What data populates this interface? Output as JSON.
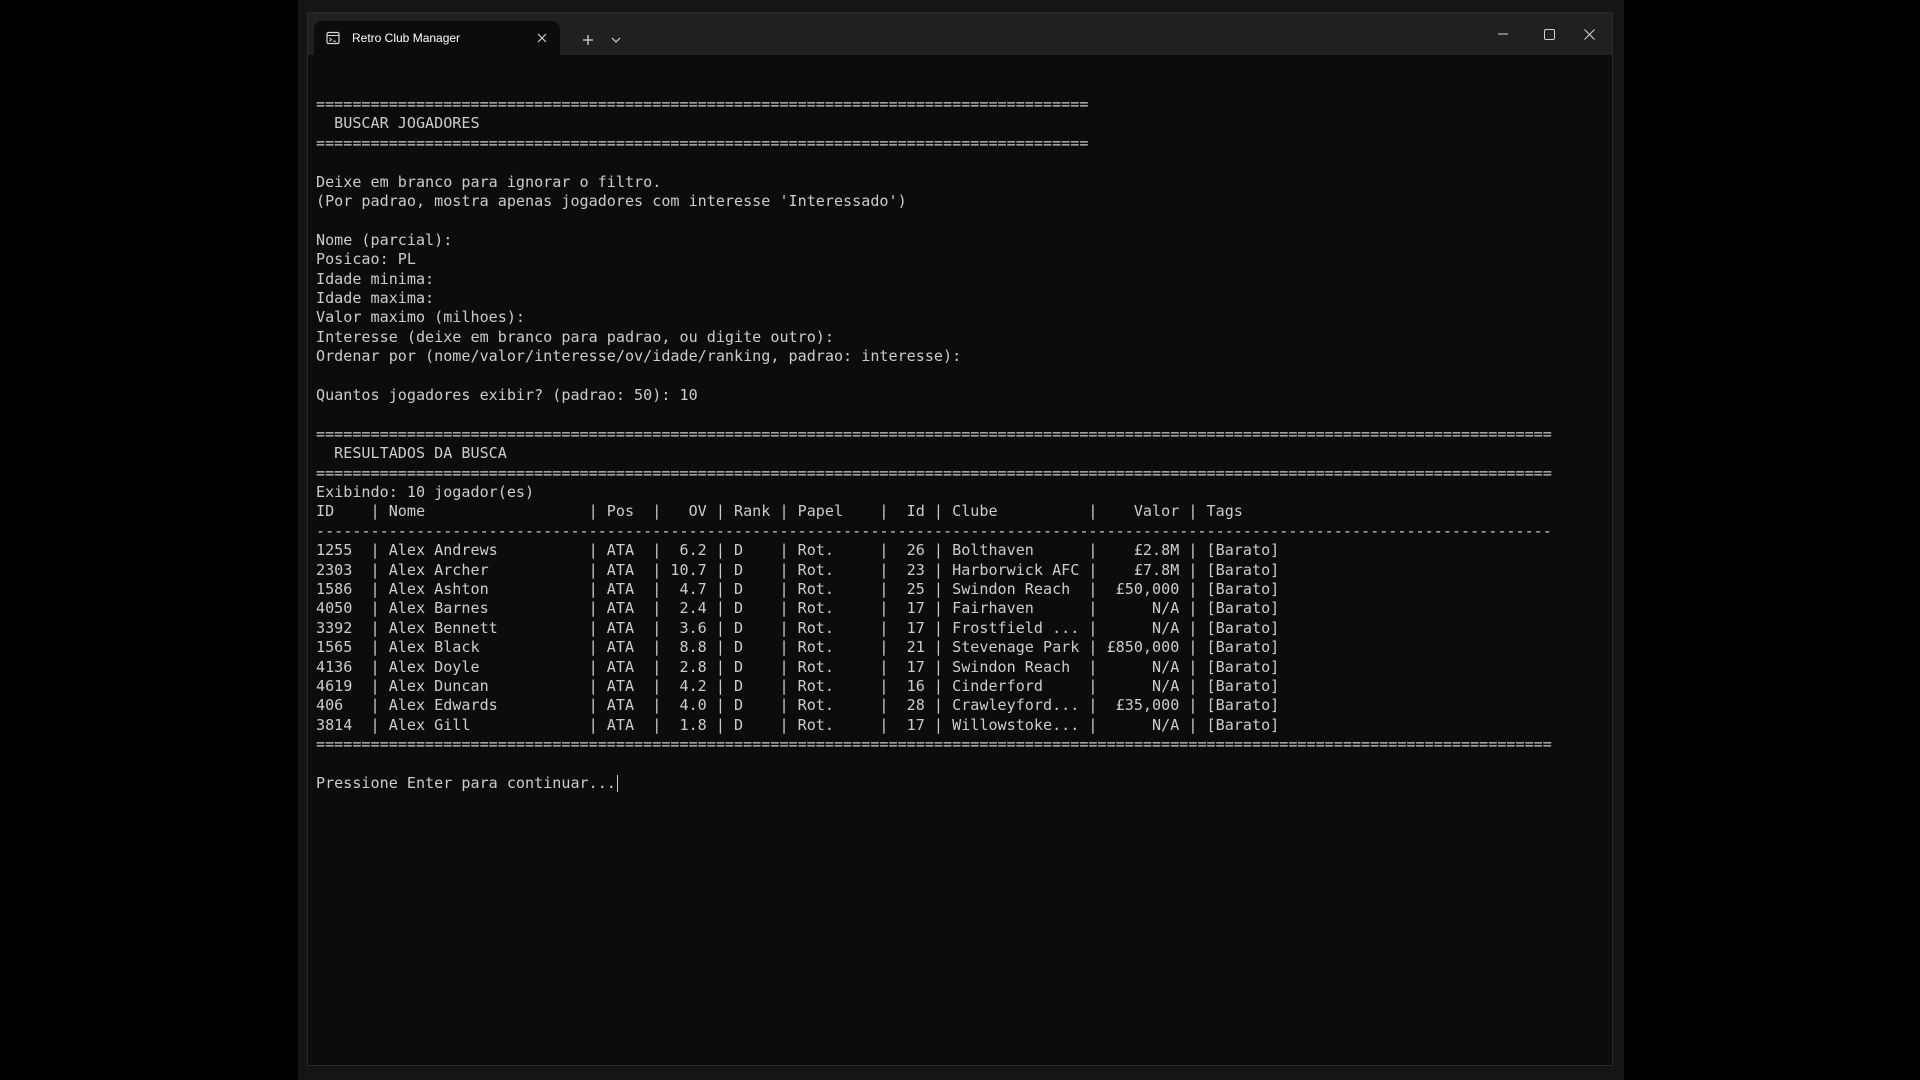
{
  "window": {
    "tab_title": "Retro Club Manager",
    "icons": {
      "tab_icon": "terminal-icon",
      "tab_close": "close-icon",
      "new_tab": "plus-icon",
      "dropdown": "chevron-down-icon",
      "minimize": "minimize-icon",
      "maximize": "maximize-icon",
      "close": "close-icon"
    }
  },
  "colors": {
    "terminal_bg": "#0c0c0c",
    "terminal_text": "#cccccc",
    "titlebar_bg": "#202020"
  },
  "terminal": {
    "lines": [
      "=====================================================================================",
      "  BUSCAR JOGADORES",
      "=====================================================================================",
      "",
      "Deixe em branco para ignorar o filtro.",
      "(Por padrao, mostra apenas jogadores com interesse 'Interessado')",
      "",
      "Nome (parcial):",
      "Posicao: PL",
      "Idade minima:",
      "Idade maxima:",
      "Valor maximo (milhoes):",
      "Interesse (deixe em branco para padrao, ou digite outro):",
      "Ordenar por (nome/valor/interesse/ov/idade/ranking, padrao: interesse):",
      "",
      "Quantos jogadores exibir? (padrao: 50): 10",
      "",
      "========================================================================================================================================",
      "  RESULTADOS DA BUSCA",
      "========================================================================================================================================",
      "Exibindo: 10 jogador(es)",
      "ID    | Nome                  | Pos  |   OV | Rank | Papel    |  Id | Clube          |    Valor | Tags",
      "----------------------------------------------------------------------------------------------------------------------------------------",
      "1255  | Alex Andrews          | ATA  |  6.2 | D    | Rot.     |  26 | Bolthaven      |    £2.8M | [Barato]",
      "2303  | Alex Archer           | ATA  | 10.7 | D    | Rot.     |  23 | Harborwick AFC |    £7.8M | [Barato]",
      "1586  | Alex Ashton           | ATA  |  4.7 | D    | Rot.     |  25 | Swindon Reach  |  £50,000 | [Barato]",
      "4050  | Alex Barnes           | ATA  |  2.4 | D    | Rot.     |  17 | Fairhaven      |      N/A | [Barato]",
      "3392  | Alex Bennett          | ATA  |  3.6 | D    | Rot.     |  17 | Frostfield ... |      N/A | [Barato]",
      "1565  | Alex Black            | ATA  |  8.8 | D    | Rot.     |  21 | Stevenage Park | £850,000 | [Barato]",
      "4136  | Alex Doyle            | ATA  |  2.8 | D    | Rot.     |  17 | Swindon Reach  |      N/A | [Barato]",
      "4619  | Alex Duncan           | ATA  |  4.2 | D    | Rot.     |  16 | Cinderford     |      N/A | [Barato]",
      "406   | Alex Edwards          | ATA  |  4.0 | D    | Rot.     |  28 | Crawleyford... |  £35,000 | [Barato]",
      "3814  | Alex Gill             | ATA  |  1.8 | D    | Rot.     |  17 | Willowstoke... |      N/A | [Barato]",
      "========================================================================================================================================",
      "",
      "Pressione Enter para continuar..."
    ]
  }
}
